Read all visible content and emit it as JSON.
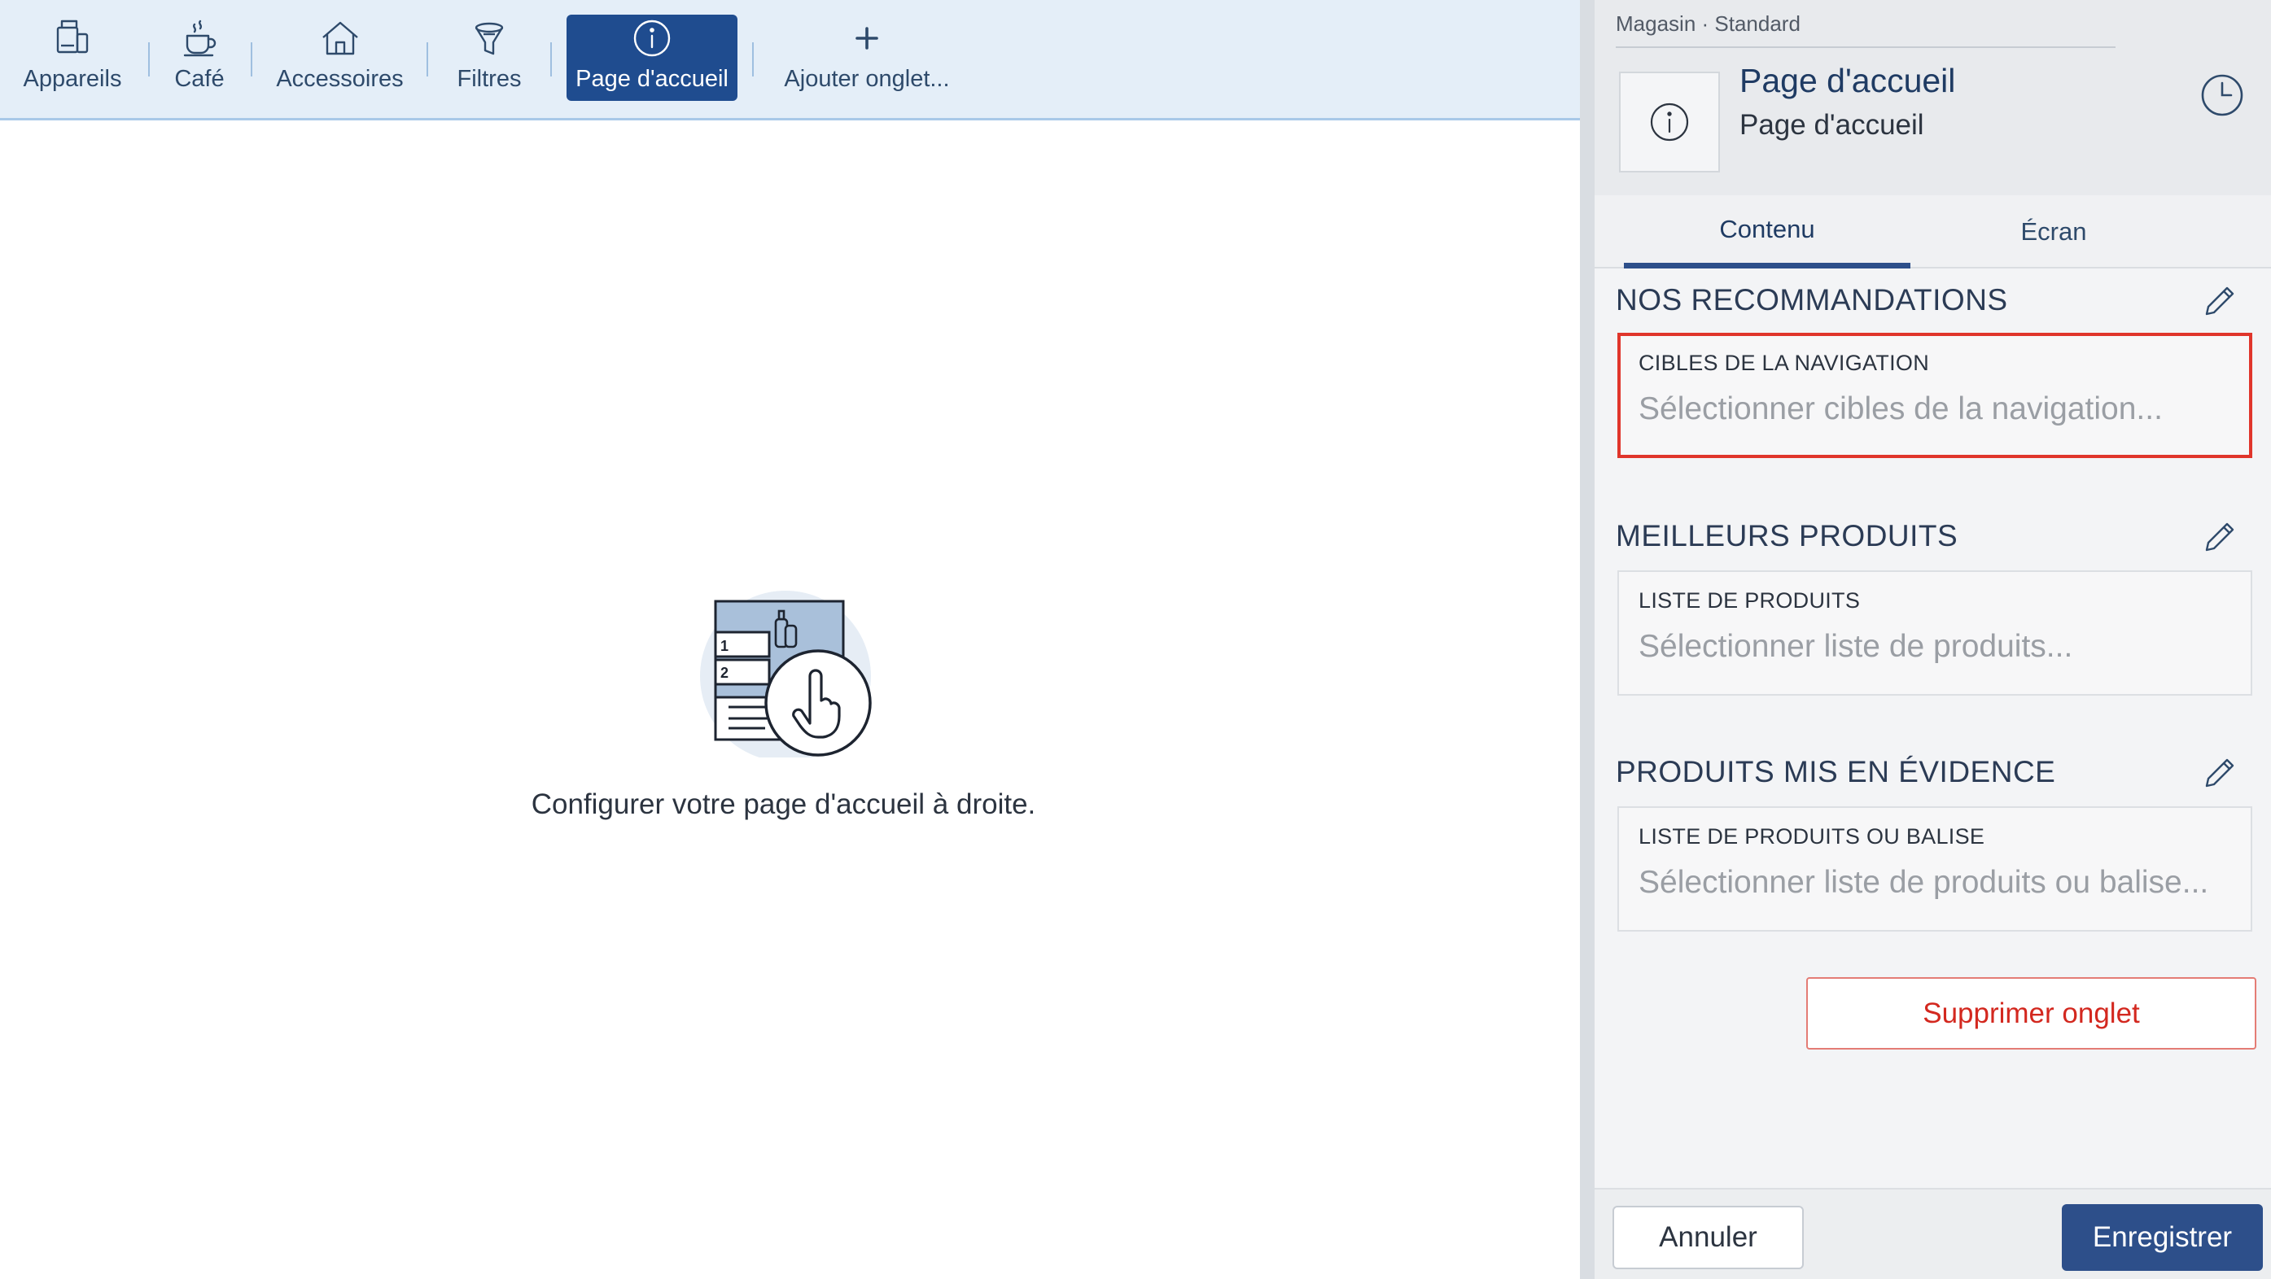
{
  "tabs": [
    {
      "label": "Appareils",
      "icon": "appliance-icon"
    },
    {
      "label": "Café",
      "icon": "coffee-cup-icon"
    },
    {
      "label": "Accessoires",
      "icon": "house-icon"
    },
    {
      "label": "Filtres",
      "icon": "funnel-icon"
    },
    {
      "label": "Page d'accueil",
      "icon": "info-icon",
      "active": true
    },
    {
      "label": "Ajouter onglet...",
      "icon": "plus-icon"
    }
  ],
  "main": {
    "message": "Configurer votre page d'accueil à droite.",
    "illustration_labels": [
      "1",
      "2"
    ]
  },
  "panel": {
    "breadcrumb": "Magasin · Standard",
    "title": "Page d'accueil",
    "subtitle": "Page d'accueil",
    "tabs": [
      {
        "label": "Contenu",
        "active": true
      },
      {
        "label": "Écran",
        "active": false
      }
    ],
    "sections": [
      {
        "title": "NOS RECOMMANDATIONS",
        "field_label": "CIBLES DE LA NAVIGATION",
        "placeholder": "Sélectionner cibles de la navigation..."
      },
      {
        "title": "MEILLEURS PRODUITS",
        "field_label": "LISTE DE PRODUITS",
        "placeholder": "Sélectionner liste de produits..."
      },
      {
        "title": "PRODUITS MIS EN ÉVIDENCE",
        "field_label": "LISTE DE PRODUITS OU BALISE",
        "placeholder": "Sélectionner liste de produits ou balise..."
      }
    ],
    "delete_label": "Supprimer onglet",
    "cancel_label": "Annuler",
    "save_label": "Enregistrer"
  },
  "colors": {
    "accent": "#1f4c8f",
    "primary_button": "#2d4f8a",
    "danger": "#d3281f",
    "highlight_border": "#e0352b",
    "tabbar_bg": "#e4eef8"
  }
}
